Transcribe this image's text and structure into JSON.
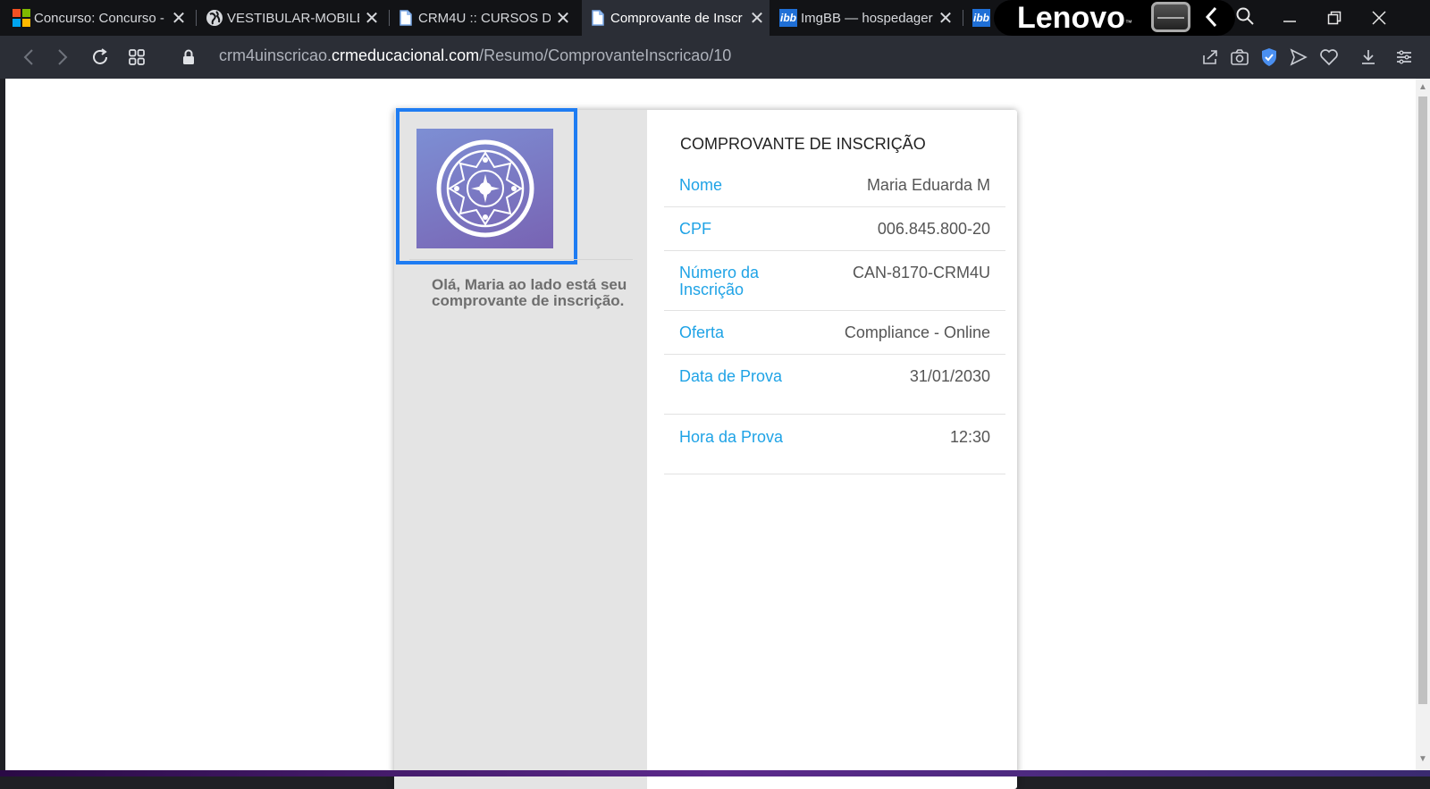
{
  "browser": {
    "tabs": [
      {
        "title": "Concurso: Concurso -",
        "icon": "microsoft-icon"
      },
      {
        "title": "VESTIBULAR-MOBILE",
        "icon": "globe-icon"
      },
      {
        "title": "CRM4U :: CURSOS DE",
        "icon": "document-icon"
      },
      {
        "title": "Comprovante de Inscr",
        "icon": "document-icon"
      },
      {
        "title": "ImgBB — hospedager",
        "icon": "imgbb-icon"
      },
      {
        "title": "",
        "icon": "imgbb-icon"
      }
    ],
    "ibb_glyph": "ibb",
    "lenovo": "Lenovo",
    "lenovo_tm": "™",
    "url": {
      "prefix": "crm4uinscricao.",
      "domain": "crmeducacional.com",
      "path": "/Resumo/ComprovanteInscricao/10"
    }
  },
  "page": {
    "greeting": "Olá, Maria ao lado está seu comprovante de inscrição.",
    "title": "COMPROVANTE DE INSCRIÇÃO",
    "fields": [
      {
        "label": "Nome",
        "value": "Maria Eduarda M"
      },
      {
        "label": "CPF",
        "value": "006.845.800-20"
      },
      {
        "label": "Número da Inscrição",
        "value": "CAN-8170-CRM4U"
      },
      {
        "label": "Oferta",
        "value": "Compliance - Online"
      },
      {
        "label": "Data de Prova",
        "value": "31/01/2030"
      },
      {
        "label": "Hora da Prova",
        "value": "12:30"
      }
    ]
  },
  "colors": {
    "accent_label": "#1fa3e6",
    "selection_border": "#1e7cf2",
    "logo_gradient_start": "#7d8fd4",
    "logo_gradient_end": "#7863b3"
  }
}
